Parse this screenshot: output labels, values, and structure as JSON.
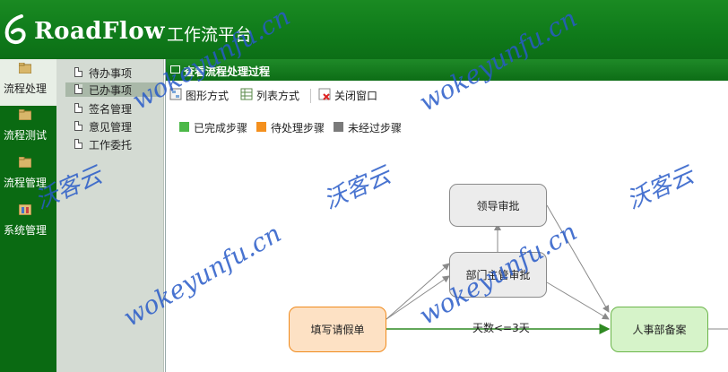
{
  "header": {
    "brand": "RoadFlow",
    "platform": "工作流平台"
  },
  "nav": {
    "items": [
      {
        "label": "流程处理"
      },
      {
        "label": "流程测试"
      },
      {
        "label": "流程管理"
      },
      {
        "label": "系统管理"
      }
    ]
  },
  "submenu": {
    "items": [
      {
        "label": "待办事项"
      },
      {
        "label": "已办事项"
      },
      {
        "label": "签名管理"
      },
      {
        "label": "意见管理"
      },
      {
        "label": "工作委托"
      }
    ]
  },
  "panel": {
    "title": "查看流程处理过程",
    "toolbar": {
      "graph_view": "图形方式",
      "list_view": "列表方式",
      "close_window": "关闭窗口"
    },
    "legend": [
      {
        "label": "已完成步骤",
        "color": "#4cb848"
      },
      {
        "label": "待处理步骤",
        "color": "#f4901e"
      },
      {
        "label": "未经过步骤",
        "color": "#7a7a7a"
      }
    ]
  },
  "flow": {
    "nodes": {
      "leader": "领导审批",
      "dept": "部门主管审批",
      "apply": "填写请假单",
      "hr": "人事部备案"
    },
    "condition": "天数<=3天"
  },
  "watermark": {
    "text_cn": "沃客云",
    "text_url": "wokeyunfu.cn"
  },
  "colors": {
    "header_green": "#0f7a1a",
    "nav_green": "#0a6a12",
    "done": "#4cb848",
    "pending": "#f4901e",
    "not_passed": "#7a7a7a"
  }
}
